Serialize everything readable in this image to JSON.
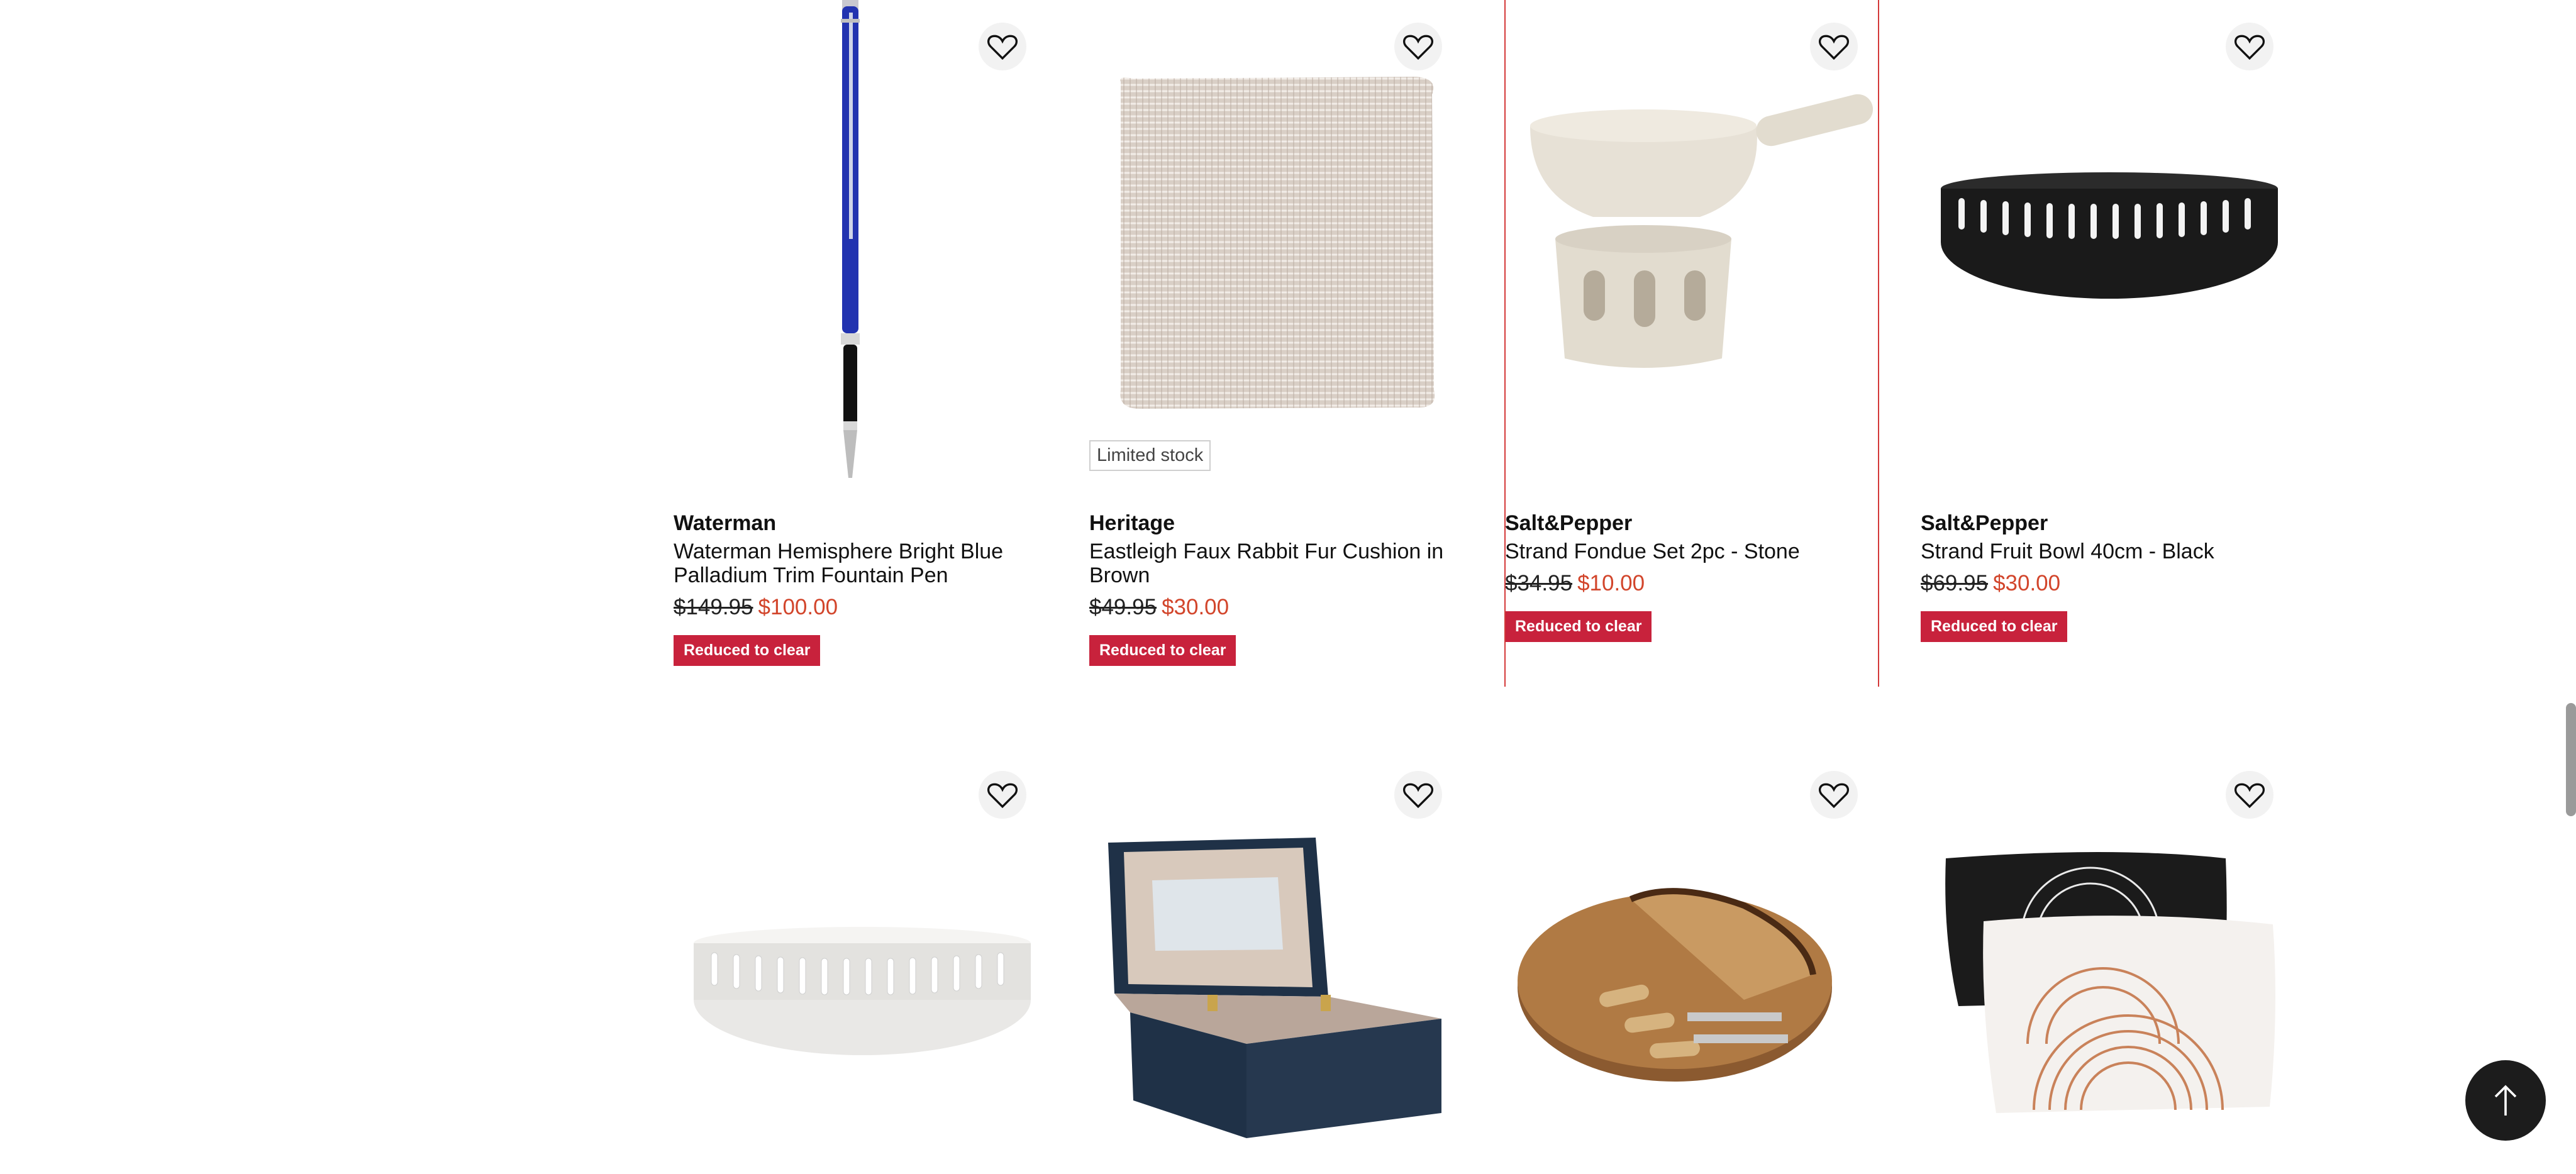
{
  "colors": {
    "accent_red": "#c8223c",
    "sale_price": "#d2452b",
    "divider_red": "#d43a3a"
  },
  "row1": [
    {
      "brand": "Waterman",
      "name": "Waterman Hemisphere Bright Blue Palladium Trim Fountain Pen",
      "was": "$149.95",
      "now": "$100.00",
      "tag": "Reduced to clear",
      "image": "fountain-pen-image"
    },
    {
      "brand": "Heritage",
      "name": "Eastleigh Faux Rabbit Fur Cushion in Brown",
      "was": "$49.95",
      "now": "$30.00",
      "tag": "Reduced to clear",
      "stock": "Limited stock",
      "image": "fur-cushion-image"
    },
    {
      "brand": "Salt&Pepper",
      "name": "Strand Fondue Set 2pc - Stone",
      "was": "$34.95",
      "now": "$10.00",
      "tag": "Reduced to clear",
      "image": "fondue-set-image"
    },
    {
      "brand": "Salt&Pepper",
      "name": "Strand Fruit Bowl 40cm - Black",
      "was": "$69.95",
      "now": "$30.00",
      "tag": "Reduced to clear",
      "image": "fruit-bowl-black-image"
    }
  ],
  "row2": [
    {
      "image": "fruit-bowl-white-image"
    },
    {
      "image": "jewellery-box-image"
    },
    {
      "image": "cheese-board-image"
    },
    {
      "image": "cushions-image"
    }
  ],
  "icons": {
    "wishlist": "heart-outline-icon",
    "back_to_top": "arrow-up-icon"
  }
}
